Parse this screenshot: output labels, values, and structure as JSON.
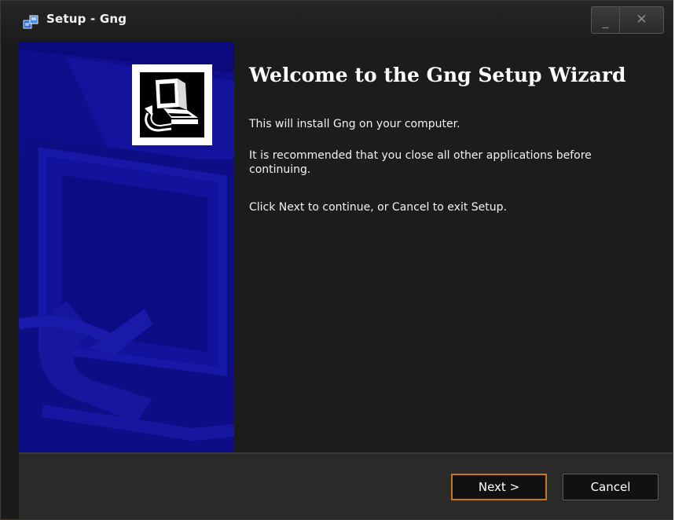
{
  "window": {
    "title": "Setup - Gng",
    "controls": {
      "minimize_glyph": "_",
      "close_glyph": "✕"
    }
  },
  "wizard": {
    "heading": "Welcome to the Gng Setup Wizard",
    "paragraphs": [
      "This will install Gng on your computer.",
      "It is recommended that you close all other applications before continuing.",
      "Click Next to continue, or Cancel to exit Setup."
    ]
  },
  "buttons": {
    "next": "Next >",
    "cancel": "Cancel"
  },
  "colors": {
    "panel_blue": "#101093",
    "next_border": "#c87a1a",
    "background": "#1c1c1c"
  },
  "icons": {
    "app": "setup-installer-icon",
    "logo": "computer-install-icon"
  }
}
